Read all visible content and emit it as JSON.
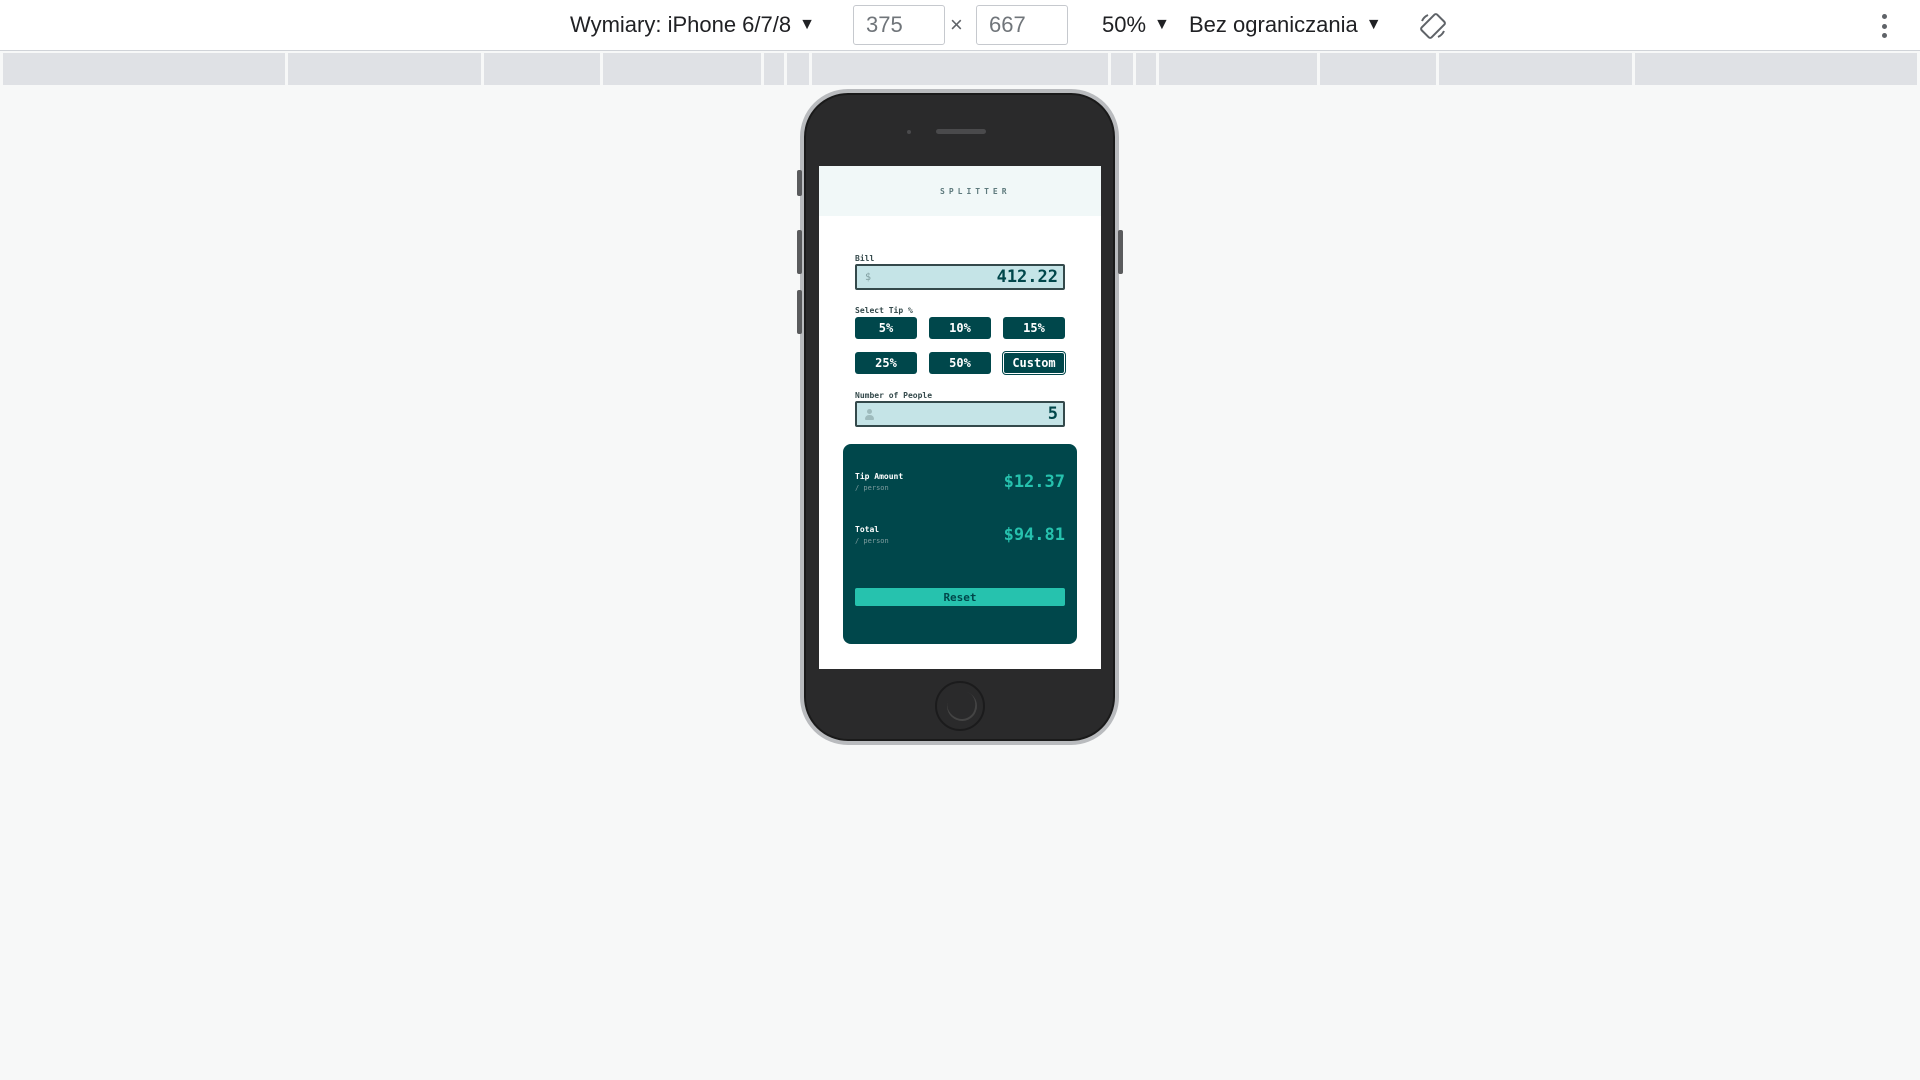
{
  "devtools": {
    "device_label": "Wymiary: iPhone 6/7/8",
    "width": "375",
    "times": "×",
    "height": "667",
    "zoom": "50%",
    "throttling": "Bez ograniczania",
    "rotate_icon": "rotate-icon",
    "menu_icon": "more-vert-icon"
  },
  "app": {
    "logo": "SPLITTER",
    "bill": {
      "label": "Bill",
      "icon": "$",
      "value": "412.22"
    },
    "tip": {
      "label": "Select Tip %",
      "options": [
        "5%",
        "10%",
        "15%",
        "25%",
        "50%",
        "Custom"
      ]
    },
    "people": {
      "label": "Number of People",
      "value": "5"
    },
    "results": {
      "tip_amount": {
        "title": "Tip Amount",
        "sub": "/ person",
        "value": "$12.37"
      },
      "total": {
        "title": "Total",
        "sub": "/ person",
        "value": "$94.81"
      },
      "reset_label": "Reset"
    }
  },
  "colors": {
    "primary": "#00474b",
    "accent": "#26c2ae",
    "input_bg": "#c5e4e7"
  }
}
